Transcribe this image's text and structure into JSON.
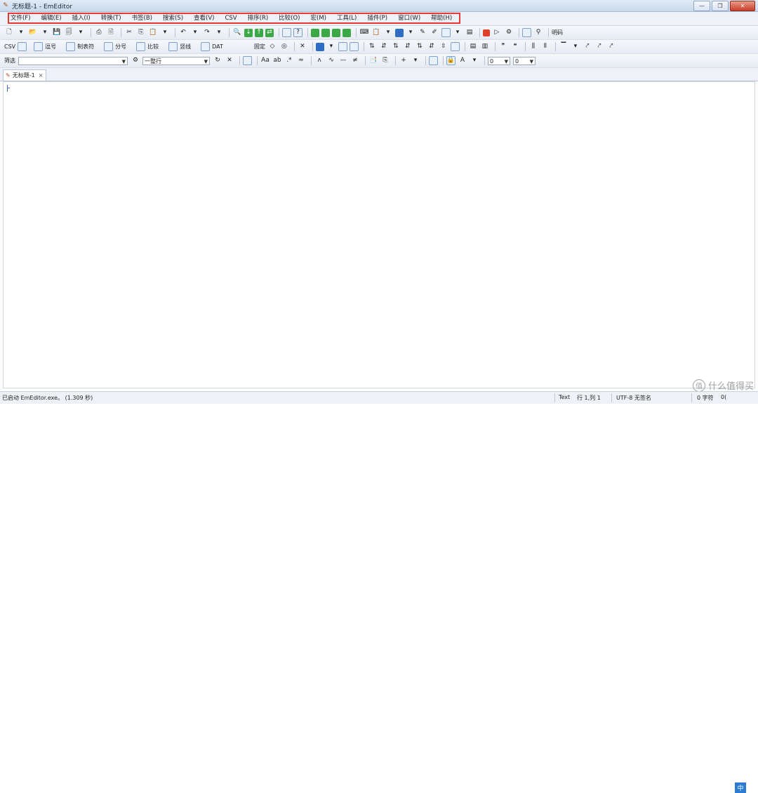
{
  "window": {
    "title": "无标题-1 - EmEditor"
  },
  "menu": [
    "文件(F)",
    "编辑(E)",
    "插入(I)",
    "转换(T)",
    "书签(B)",
    "搜索(S)",
    "查看(V)",
    "CSV",
    "排序(R)",
    "比较(O)",
    "宏(M)",
    "工具(L)",
    "插件(P)",
    "窗口(W)",
    "帮助(H)"
  ],
  "toolbar1": {
    "macro_label": "明码"
  },
  "toolbar2": {
    "csv_label": "CSV",
    "buttons": [
      "逗号",
      "制表符",
      "分号",
      "比较",
      "竖线",
      "DAT"
    ],
    "column_label": "固定"
  },
  "toolbar3": {
    "filter_label": "筛选",
    "filter_value": "",
    "scope_value": "一整行",
    "num1": "0",
    "num2": "0"
  },
  "tabs": [
    {
      "label": "无标题-1",
      "close": "×"
    }
  ],
  "status": {
    "message": "已启动 EmEditor.exe。 (1.309 秒)",
    "mode": "Text",
    "position": "行 1,列 1",
    "encoding": "UTF-8 无签名",
    "chars": "0 字符",
    "extra": "0("
  },
  "watermark": {
    "text": "什么值得买"
  }
}
